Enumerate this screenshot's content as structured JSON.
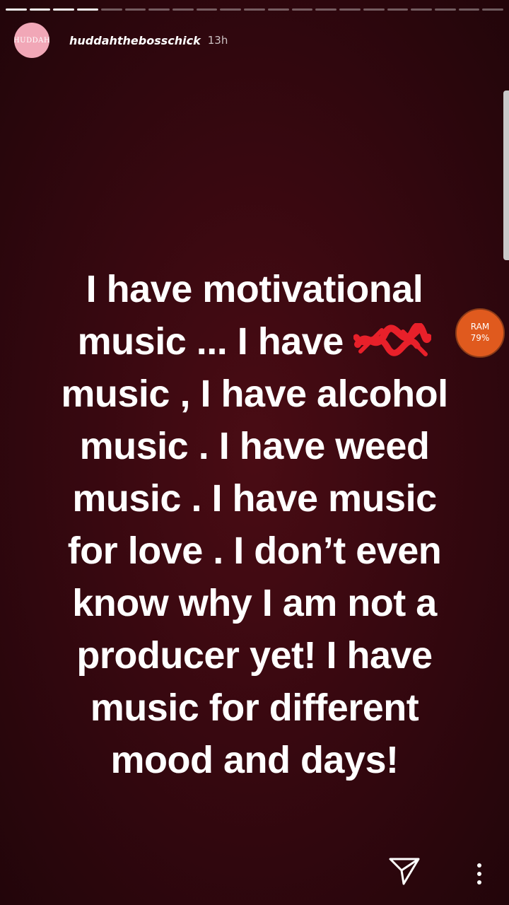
{
  "story": {
    "username": "huddahthebosschick",
    "time_ago": "13h",
    "avatar_text": "HUDDAH",
    "progress_segments_total": 21,
    "progress_segments_viewed": 4,
    "lines": [
      "I have motivational",
      "music ... I have",
      "music , I have alcohol",
      "music . I have weed",
      "music . I have music",
      "for love . I don’t even",
      "know why I am not a",
      "producer yet! I have",
      "music for different",
      "mood and days!"
    ],
    "censor_color": "#e8202a"
  },
  "ram_widget": {
    "label": "RAM",
    "value": "79%",
    "color": "#e05a1e"
  },
  "theme": {
    "background": "#380810",
    "text": "#ffffff"
  },
  "icons": {
    "send": "send-icon",
    "more": "more-vertical-icon"
  }
}
